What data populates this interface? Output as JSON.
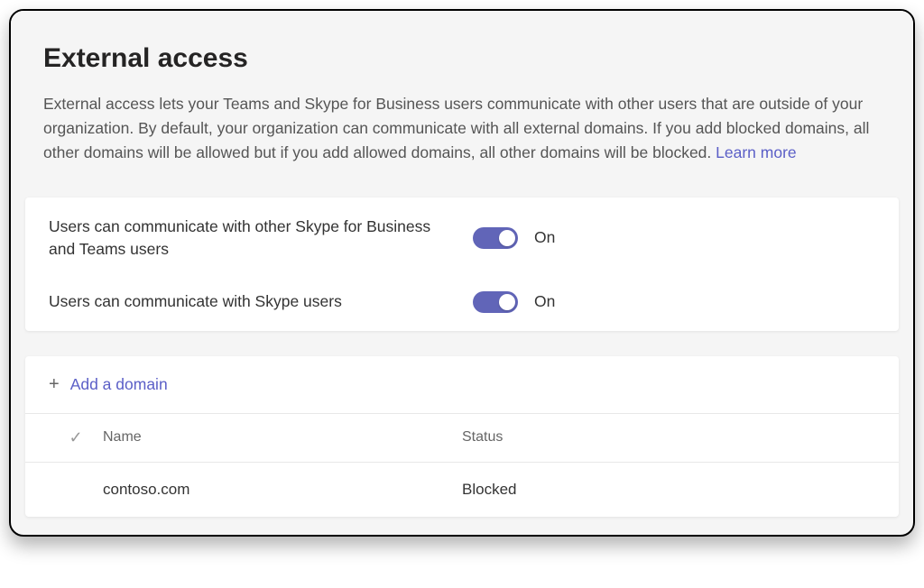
{
  "header": {
    "title": "External access",
    "description": "External access lets your Teams and Skype for Business users communicate with other users that are outside of your organization. By default, your organization can communicate with all external domains. If you add blocked domains, all other domains will be allowed but if you add allowed domains, all other domains will be blocked. ",
    "learn_more": "Learn more"
  },
  "settings": [
    {
      "label": "Users can communicate with other Skype for Business and Teams users",
      "state": "On"
    },
    {
      "label": "Users can communicate with Skype users",
      "state": "On"
    }
  ],
  "domains": {
    "add_button": "Add a domain",
    "columns": {
      "name": "Name",
      "status": "Status"
    },
    "rows": [
      {
        "name": "contoso.com",
        "status": "Blocked"
      }
    ]
  }
}
